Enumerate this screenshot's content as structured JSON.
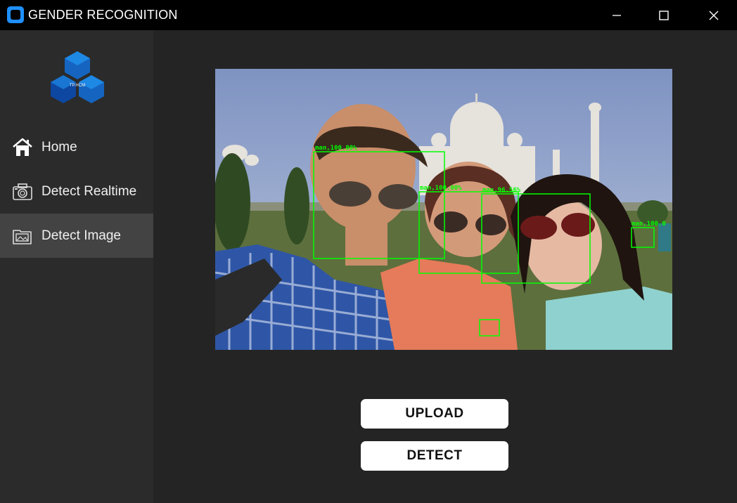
{
  "window": {
    "title": "GENDER RECOGNITION",
    "minimize_icon": "minimize-icon",
    "maximize_icon": "maximize-icon",
    "close_icon": "close-icon"
  },
  "sidebar": {
    "logo_text": "TP.HCM",
    "items": [
      {
        "label": "Home",
        "icon": "home-icon",
        "active": false
      },
      {
        "label": "Detect Realtime",
        "icon": "camera-icon",
        "active": false
      },
      {
        "label": "Detect Image",
        "icon": "image-folder-icon",
        "active": true
      }
    ]
  },
  "main": {
    "detections": [
      {
        "label": "man,100.00%"
      },
      {
        "label": "man,100.00%"
      },
      {
        "label": "man,96.56%"
      },
      {
        "label": "man,100.0"
      }
    ],
    "upload_label": "UPLOAD",
    "detect_label": "DETECT"
  },
  "colors": {
    "titlebar": "#000000",
    "sidebar": "#2b2b2b",
    "sidebar_active": "#434343",
    "main_bg": "#242424",
    "detection_box": "#00ff00",
    "button_bg": "#ffffff"
  }
}
